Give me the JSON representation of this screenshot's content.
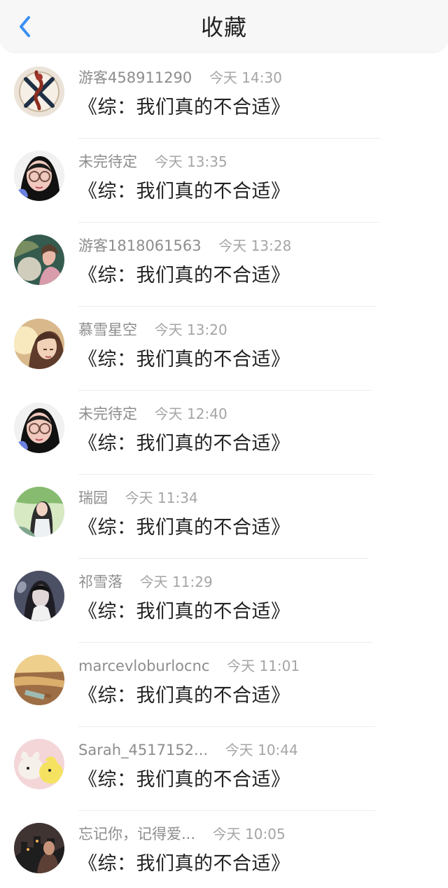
{
  "header": {
    "title": "收藏",
    "back_icon": "chevron-left-icon",
    "accent": "#3a8ff3"
  },
  "items": [
    {
      "user": "游客458911290",
      "time": "今天 14:30",
      "book": "《综：我们真的不合适》",
      "avatar_icon": "crossed-swords-avatar"
    },
    {
      "user": "未完待定",
      "time": "今天 13:35",
      "book": "《综：我们真的不合适》",
      "avatar_icon": "girl-glasses-avatar"
    },
    {
      "user": "游客1818061563",
      "time": "今天 13:28",
      "book": "《综：我们真的不合适》",
      "avatar_icon": "moon-girl-avatar"
    },
    {
      "user": "慕雪星空",
      "time": "今天 13:20",
      "book": "《综：我们真的不合适》",
      "avatar_icon": "anime-girl-avatar"
    },
    {
      "user": "未完待定",
      "time": "今天 12:40",
      "book": "《综：我们真的不合适》",
      "avatar_icon": "girl-glasses-avatar"
    },
    {
      "user": "瑞园",
      "time": "今天 11:34",
      "book": "《综：我们真的不合适》",
      "avatar_icon": "girl-outdoor-avatar"
    },
    {
      "user": "祁雪落",
      "time": "今天 11:29",
      "book": "《综：我们真的不合适》",
      "avatar_icon": "dark-anime-avatar"
    },
    {
      "user": "marcevloburlocnc",
      "time": "今天 11:01",
      "book": "《综：我们真的不合适》",
      "avatar_icon": "bottle-sunset-avatar"
    },
    {
      "user": "Sarah_4517152...",
      "time": "今天 10:44",
      "book": "《综：我们真的不合适》",
      "avatar_icon": "toys-avatar"
    },
    {
      "user": "忘记你，记得爱...",
      "time": "今天 10:05",
      "book": "《综：我们真的不合适》",
      "avatar_icon": "night-city-avatar"
    }
  ]
}
